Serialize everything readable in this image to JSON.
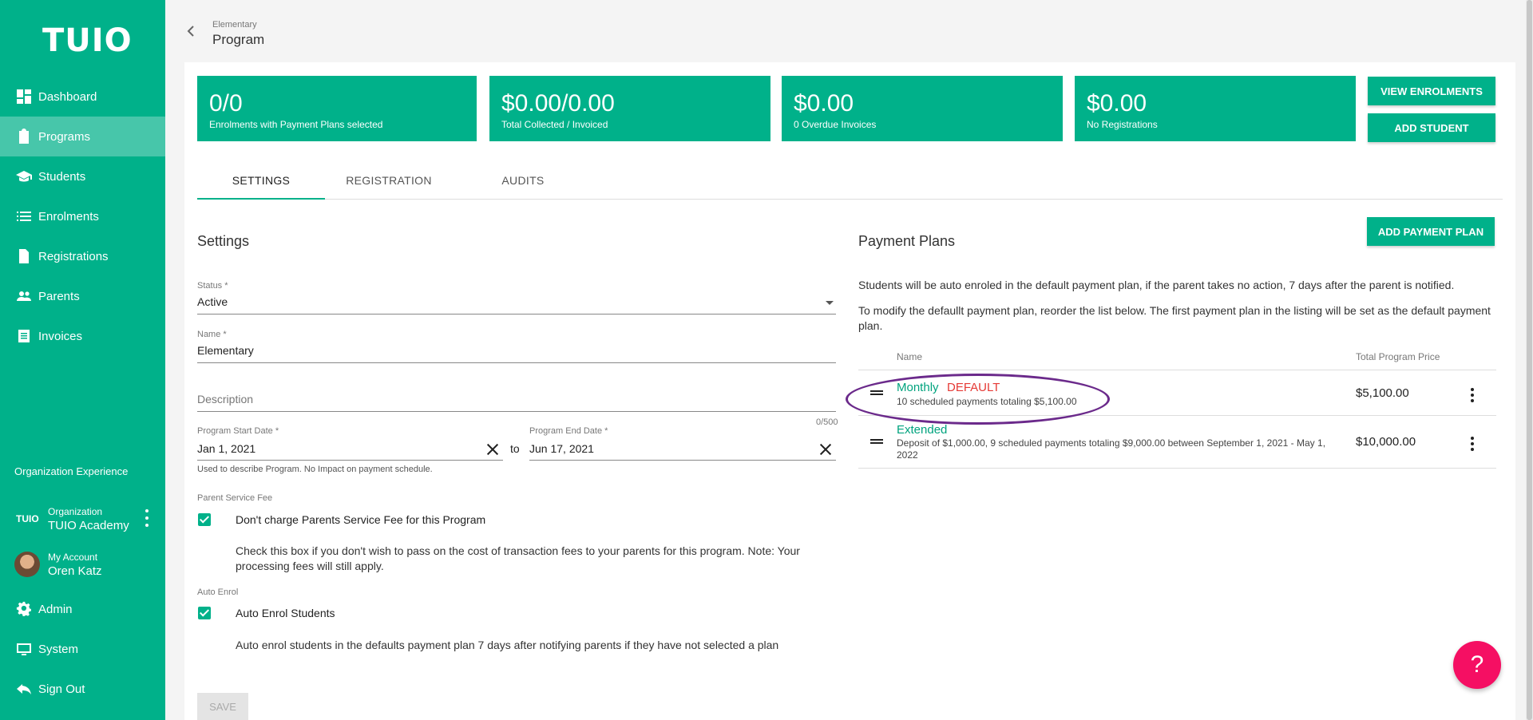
{
  "brand": {
    "logo": "TUIO",
    "accent": "#00b18a"
  },
  "sidebar": {
    "items": [
      {
        "label": "Dashboard",
        "icon": "dashboard-icon",
        "active": false
      },
      {
        "label": "Programs",
        "icon": "clipboard-icon",
        "active": true
      },
      {
        "label": "Students",
        "icon": "graduation-cap-icon",
        "active": false
      },
      {
        "label": "Enrolments",
        "icon": "list-icon",
        "active": false
      },
      {
        "label": "Registrations",
        "icon": "document-icon",
        "active": false
      },
      {
        "label": "Parents",
        "icon": "people-icon",
        "active": false
      },
      {
        "label": "Invoices",
        "icon": "invoice-icon",
        "active": false
      }
    ],
    "org_section_title": "Organization Experience",
    "org": {
      "logo": "TUIO",
      "label": "Organization",
      "name": "TUIO Academy"
    },
    "account": {
      "label": "My Account",
      "name": "Oren Katz"
    },
    "bottom_items": [
      {
        "label": "Admin",
        "icon": "gear-icon"
      },
      {
        "label": "System",
        "icon": "monitor-icon"
      },
      {
        "label": "Sign Out",
        "icon": "sign-out-icon"
      }
    ]
  },
  "header": {
    "breadcrumb": "Elementary",
    "title": "Program"
  },
  "stats": [
    {
      "value": "0/0",
      "label": "Enrolments with Payment Plans selected"
    },
    {
      "value": "$0.00/0.00",
      "label": "Total Collected / Invoiced"
    },
    {
      "value": "$0.00",
      "label": "0 Overdue Invoices"
    },
    {
      "value": "$0.00",
      "label": "No Registrations"
    }
  ],
  "actions": {
    "view_enrolments": "VIEW ENROLMENTS",
    "add_student": "ADD STUDENT",
    "add_payment_plan": "ADD PAYMENT PLAN"
  },
  "tabs": [
    {
      "label": "SETTINGS"
    },
    {
      "label": "REGISTRATION"
    },
    {
      "label": "AUDITS"
    }
  ],
  "settings": {
    "title": "Settings",
    "status_label": "Status *",
    "status_value": "Active",
    "name_label": "Name *",
    "name_value": "Elementary",
    "description_placeholder": "Description",
    "description_counter": "0/500",
    "start_label": "Program Start Date *",
    "start_value": "Jan 1, 2021",
    "to_label": "to",
    "end_label": "Program End Date *",
    "end_value": "Jun 17, 2021",
    "date_helper": "Used to describe Program. No Impact on payment schedule.",
    "service_fee_label": "Parent Service Fee",
    "service_fee_check": "Don't charge Parents Service Fee for this Program",
    "service_fee_note": "Check this box if you don't wish to pass on the cost of transaction fees to your parents for this program. Note: Your processing fees will still apply.",
    "auto_enrol_label": "Auto Enrol",
    "auto_enrol_check": "Auto Enrol Students",
    "auto_enrol_note": "Auto enrol students in the defaults payment plan 7 days after notifying parents if they have not selected a plan",
    "save_label": "SAVE"
  },
  "payment_plans": {
    "title": "Payment Plans",
    "note1": "Students will be auto enroled in the default payment plan, if the parent takes no action, 7 days after the parent is notified.",
    "note2": "To modify the defaullt payment plan, reorder the list below. The first payment plan in the listing will be set as the default payment plan.",
    "col_name": "Name",
    "col_price": "Total Program Price",
    "rows": [
      {
        "name": "Monthly",
        "badge": "DEFAULT",
        "desc": "10 scheduled payments totaling $5,100.00",
        "price": "$5,100.00"
      },
      {
        "name": "Extended",
        "badge": "",
        "desc": "Deposit of $1,000.00, 9 scheduled payments totaling $9,000.00 between September 1, 2021 - May 1, 2022",
        "price": "$10,000.00"
      }
    ]
  },
  "help": {
    "label": "?"
  }
}
